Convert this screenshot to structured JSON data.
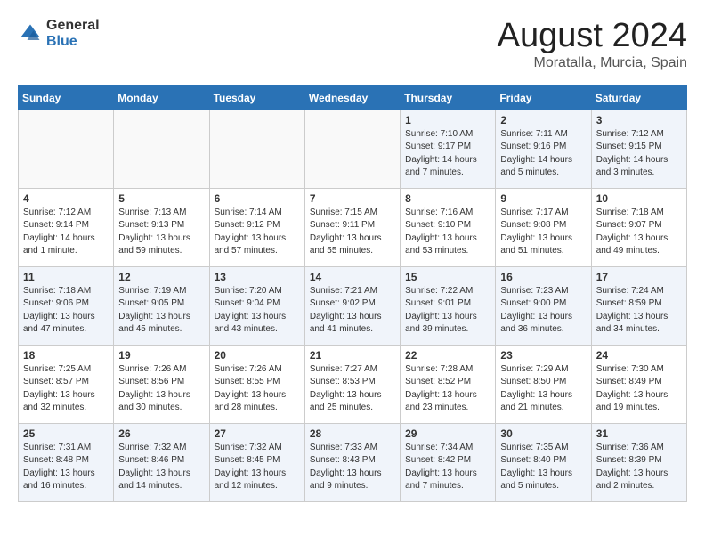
{
  "logo": {
    "general": "General",
    "blue": "Blue"
  },
  "title": {
    "month": "August 2024",
    "location": "Moratalla, Murcia, Spain"
  },
  "headers": [
    "Sunday",
    "Monday",
    "Tuesday",
    "Wednesday",
    "Thursday",
    "Friday",
    "Saturday"
  ],
  "weeks": [
    [
      {
        "num": "",
        "info": ""
      },
      {
        "num": "",
        "info": ""
      },
      {
        "num": "",
        "info": ""
      },
      {
        "num": "",
        "info": ""
      },
      {
        "num": "1",
        "info": "Sunrise: 7:10 AM\nSunset: 9:17 PM\nDaylight: 14 hours\nand 7 minutes."
      },
      {
        "num": "2",
        "info": "Sunrise: 7:11 AM\nSunset: 9:16 PM\nDaylight: 14 hours\nand 5 minutes."
      },
      {
        "num": "3",
        "info": "Sunrise: 7:12 AM\nSunset: 9:15 PM\nDaylight: 14 hours\nand 3 minutes."
      }
    ],
    [
      {
        "num": "4",
        "info": "Sunrise: 7:12 AM\nSunset: 9:14 PM\nDaylight: 14 hours\nand 1 minute."
      },
      {
        "num": "5",
        "info": "Sunrise: 7:13 AM\nSunset: 9:13 PM\nDaylight: 13 hours\nand 59 minutes."
      },
      {
        "num": "6",
        "info": "Sunrise: 7:14 AM\nSunset: 9:12 PM\nDaylight: 13 hours\nand 57 minutes."
      },
      {
        "num": "7",
        "info": "Sunrise: 7:15 AM\nSunset: 9:11 PM\nDaylight: 13 hours\nand 55 minutes."
      },
      {
        "num": "8",
        "info": "Sunrise: 7:16 AM\nSunset: 9:10 PM\nDaylight: 13 hours\nand 53 minutes."
      },
      {
        "num": "9",
        "info": "Sunrise: 7:17 AM\nSunset: 9:08 PM\nDaylight: 13 hours\nand 51 minutes."
      },
      {
        "num": "10",
        "info": "Sunrise: 7:18 AM\nSunset: 9:07 PM\nDaylight: 13 hours\nand 49 minutes."
      }
    ],
    [
      {
        "num": "11",
        "info": "Sunrise: 7:18 AM\nSunset: 9:06 PM\nDaylight: 13 hours\nand 47 minutes."
      },
      {
        "num": "12",
        "info": "Sunrise: 7:19 AM\nSunset: 9:05 PM\nDaylight: 13 hours\nand 45 minutes."
      },
      {
        "num": "13",
        "info": "Sunrise: 7:20 AM\nSunset: 9:04 PM\nDaylight: 13 hours\nand 43 minutes."
      },
      {
        "num": "14",
        "info": "Sunrise: 7:21 AM\nSunset: 9:02 PM\nDaylight: 13 hours\nand 41 minutes."
      },
      {
        "num": "15",
        "info": "Sunrise: 7:22 AM\nSunset: 9:01 PM\nDaylight: 13 hours\nand 39 minutes."
      },
      {
        "num": "16",
        "info": "Sunrise: 7:23 AM\nSunset: 9:00 PM\nDaylight: 13 hours\nand 36 minutes."
      },
      {
        "num": "17",
        "info": "Sunrise: 7:24 AM\nSunset: 8:59 PM\nDaylight: 13 hours\nand 34 minutes."
      }
    ],
    [
      {
        "num": "18",
        "info": "Sunrise: 7:25 AM\nSunset: 8:57 PM\nDaylight: 13 hours\nand 32 minutes."
      },
      {
        "num": "19",
        "info": "Sunrise: 7:26 AM\nSunset: 8:56 PM\nDaylight: 13 hours\nand 30 minutes."
      },
      {
        "num": "20",
        "info": "Sunrise: 7:26 AM\nSunset: 8:55 PM\nDaylight: 13 hours\nand 28 minutes."
      },
      {
        "num": "21",
        "info": "Sunrise: 7:27 AM\nSunset: 8:53 PM\nDaylight: 13 hours\nand 25 minutes."
      },
      {
        "num": "22",
        "info": "Sunrise: 7:28 AM\nSunset: 8:52 PM\nDaylight: 13 hours\nand 23 minutes."
      },
      {
        "num": "23",
        "info": "Sunrise: 7:29 AM\nSunset: 8:50 PM\nDaylight: 13 hours\nand 21 minutes."
      },
      {
        "num": "24",
        "info": "Sunrise: 7:30 AM\nSunset: 8:49 PM\nDaylight: 13 hours\nand 19 minutes."
      }
    ],
    [
      {
        "num": "25",
        "info": "Sunrise: 7:31 AM\nSunset: 8:48 PM\nDaylight: 13 hours\nand 16 minutes."
      },
      {
        "num": "26",
        "info": "Sunrise: 7:32 AM\nSunset: 8:46 PM\nDaylight: 13 hours\nand 14 minutes."
      },
      {
        "num": "27",
        "info": "Sunrise: 7:32 AM\nSunset: 8:45 PM\nDaylight: 13 hours\nand 12 minutes."
      },
      {
        "num": "28",
        "info": "Sunrise: 7:33 AM\nSunset: 8:43 PM\nDaylight: 13 hours\nand 9 minutes."
      },
      {
        "num": "29",
        "info": "Sunrise: 7:34 AM\nSunset: 8:42 PM\nDaylight: 13 hours\nand 7 minutes."
      },
      {
        "num": "30",
        "info": "Sunrise: 7:35 AM\nSunset: 8:40 PM\nDaylight: 13 hours\nand 5 minutes."
      },
      {
        "num": "31",
        "info": "Sunrise: 7:36 AM\nSunset: 8:39 PM\nDaylight: 13 hours\nand 2 minutes."
      }
    ]
  ]
}
